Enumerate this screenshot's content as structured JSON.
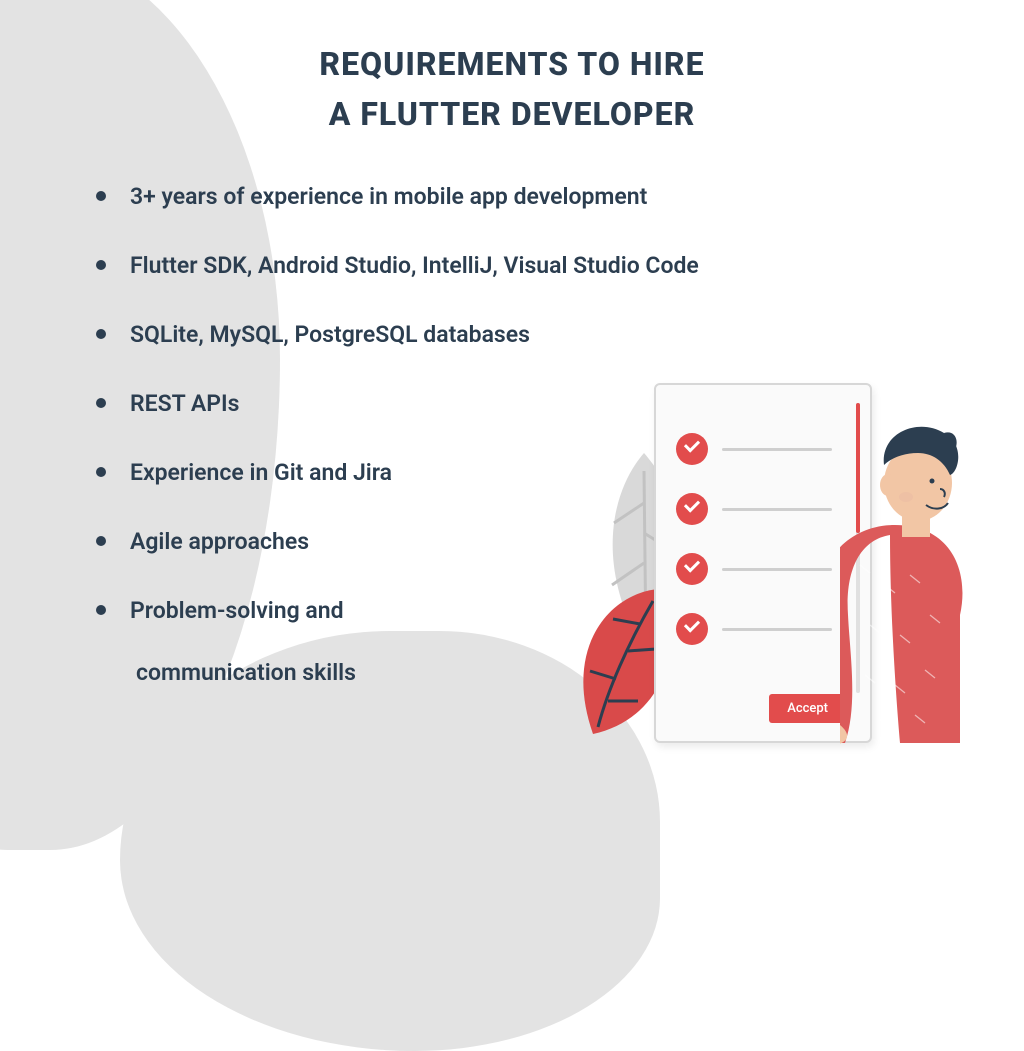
{
  "title_line1": "REQUIREMENTS TO HIRE",
  "title_line2": "A FLUTTER DEVELOPER",
  "requirements": [
    "3+ years of experience in mobile app development",
    "Flutter SDK, Android Studio, IntelliJ, Visual Studio Code",
    "SQLite, MySQL, PostgreSQL databases",
    "REST APIs",
    "Experience in Git and Jira",
    "Agile approaches"
  ],
  "req7_line1": "Problem-solving and",
  "req7_line2": "communication skills",
  "accept_label": "Accept"
}
